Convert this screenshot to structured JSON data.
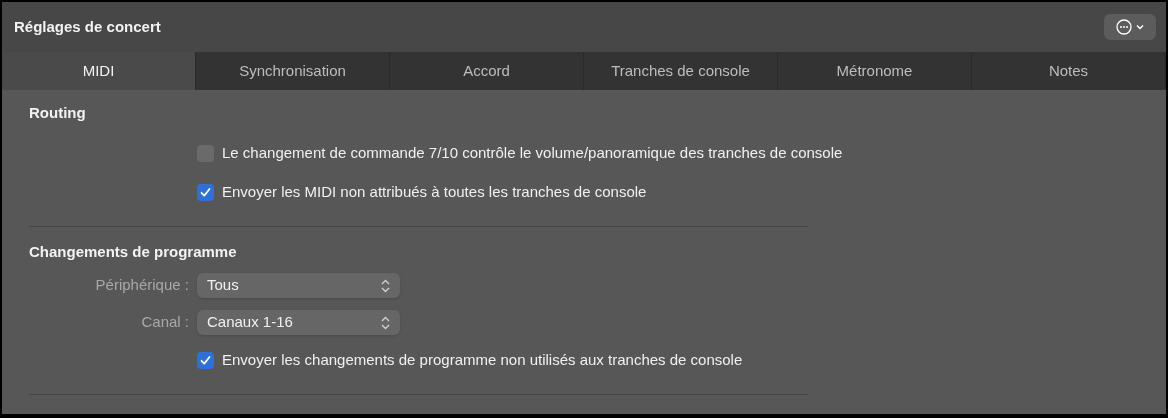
{
  "window": {
    "title": "Réglages de concert"
  },
  "tabs": [
    {
      "label": "MIDI",
      "selected": true
    },
    {
      "label": "Synchronisation",
      "selected": false
    },
    {
      "label": "Accord",
      "selected": false
    },
    {
      "label": "Tranches de console",
      "selected": false
    },
    {
      "label": "Métronome",
      "selected": false
    },
    {
      "label": "Notes",
      "selected": false
    }
  ],
  "sections": [
    {
      "title": "Routing",
      "rows": [
        {
          "kind": "checkbox",
          "label": "Le changement de commande 7/10 contrôle le volume/panoramique des tranches de console",
          "checked": false
        },
        {
          "kind": "checkbox",
          "label": "Envoyer les MIDI non attribués à toutes les tranches de console",
          "checked": true
        }
      ]
    },
    {
      "title": "Changements de programme",
      "rows": [
        {
          "kind": "popup",
          "label": "Périphérique :",
          "value": "Tous"
        },
        {
          "kind": "popup",
          "label": "Canal :",
          "value": "Canaux 1-16"
        },
        {
          "kind": "checkbox",
          "label": "Envoyer les changements de programme non utilisés aux tranches de console",
          "checked": true
        }
      ]
    }
  ]
}
